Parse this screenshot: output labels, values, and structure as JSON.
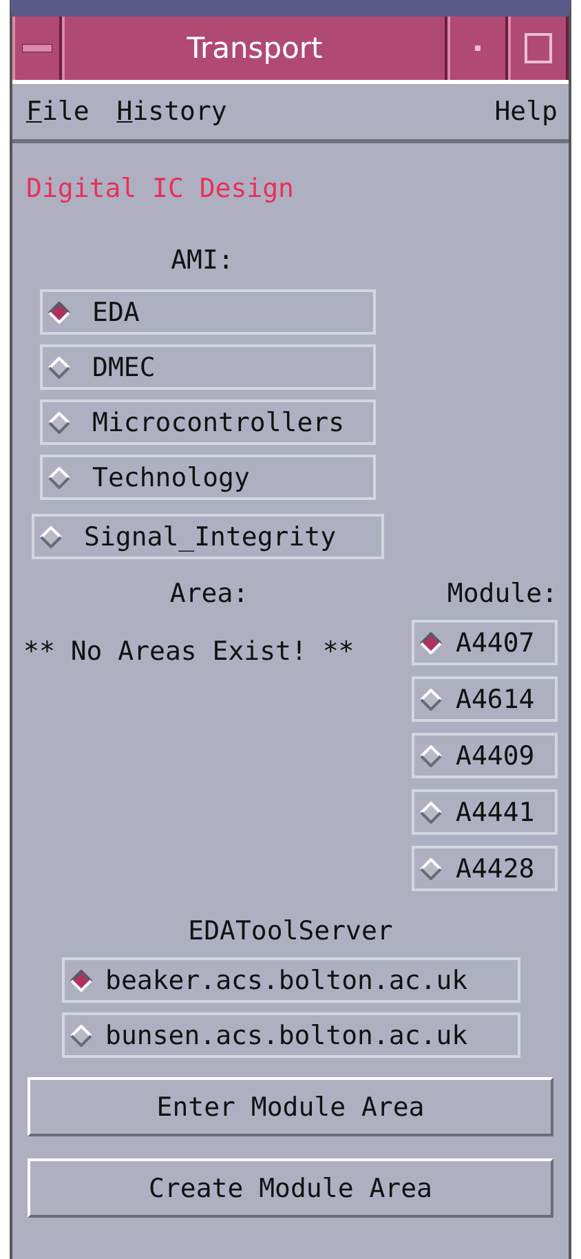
{
  "window": {
    "title": "Transport"
  },
  "menu": [
    {
      "label": "File",
      "underline_first": true
    },
    {
      "label": "History",
      "underline_first": true
    },
    {
      "label": "Help",
      "underline_first": false
    }
  ],
  "heading": "Digital IC Design",
  "ami": {
    "label": "AMI:",
    "options": [
      {
        "label": "EDA",
        "selected": true
      },
      {
        "label": "DMEC",
        "selected": false
      },
      {
        "label": "Microcontrollers",
        "selected": false
      },
      {
        "label": "Technology",
        "selected": false
      },
      {
        "label": "Signal_Integrity",
        "selected": false
      }
    ]
  },
  "area": {
    "label": "Area:",
    "message": "** No Areas Exist! **"
  },
  "module": {
    "label": "Module:",
    "options": [
      {
        "label": "A4407",
        "selected": true
      },
      {
        "label": "A4614",
        "selected": false
      },
      {
        "label": "A4409",
        "selected": false
      },
      {
        "label": "A4441",
        "selected": false
      },
      {
        "label": "A4428",
        "selected": false
      }
    ]
  },
  "server": {
    "label": "EDAToolServer",
    "options": [
      {
        "label": "beaker.acs.bolton.ac.uk",
        "selected": true
      },
      {
        "label": "bunsen.acs.bolton.ac.uk",
        "selected": false
      }
    ]
  },
  "buttons": [
    "Enter Module Area",
    "Create Module Area"
  ]
}
